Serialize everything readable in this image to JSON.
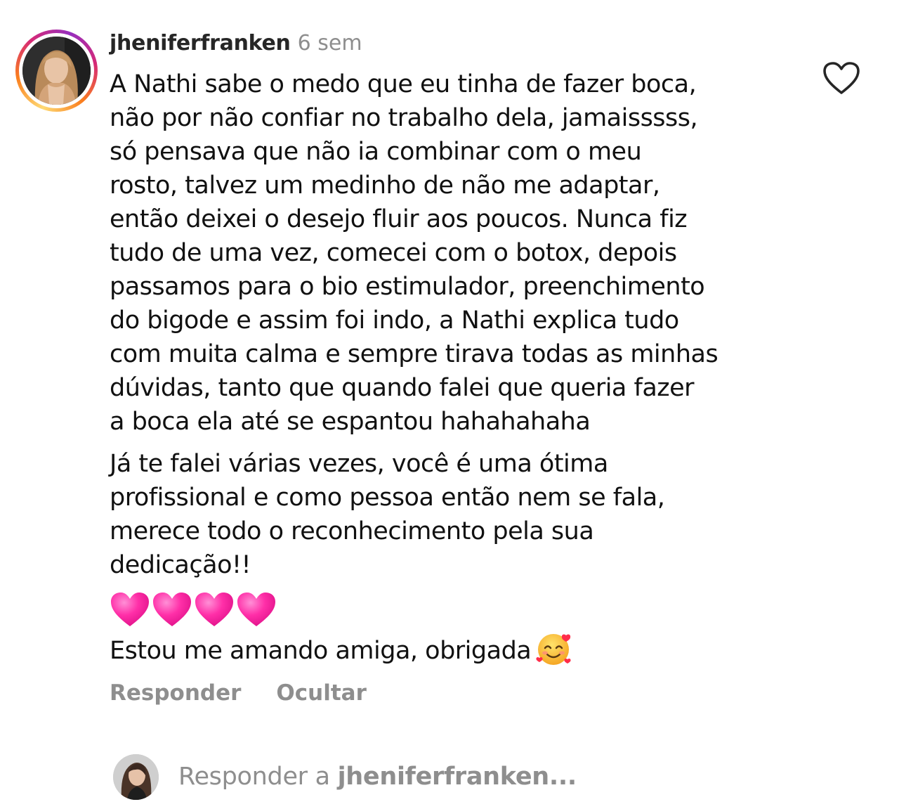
{
  "comment": {
    "username": "jheniferfranken",
    "timestamp": "6 sem",
    "paragraph_1": "A Nathi sabe o medo que eu tinha de fazer boca,\nnão por não confiar no trabalho dela, jamaisssss,\nsó pensava que não ia combinar com o meu\nrosto, talvez um medinho de não me adaptar,\nentão deixei o desejo fluir aos poucos. Nunca fiz\ntudo de uma vez, comecei com o botox, depois\npassamos para o bio estimulador, preenchimento\ndo bigode e assim foi indo, a Nathi explica tudo\ncom muita calma e sempre tirava todas as minhas\ndúvidas, tanto que quando falei que queria fazer\na boca ela até se espantou hahahahaha",
    "paragraph_2": "Já te falei várias vezes, você é uma ótima\nprofissional e como pessoa então nem se fala,\nmerece todo o reconhecimento pela sua\ndedicação!!",
    "hearts": [
      "pink-heart",
      "pink-heart",
      "pink-heart",
      "pink-heart"
    ],
    "paragraph_3": "Estou me amando amiga, obrigada",
    "paragraph_3_emoji": "smiling-face-with-hearts",
    "actions": {
      "reply_label": "Responder",
      "hide_label": "Ocultar"
    },
    "like_icon": "heart-outline-icon",
    "ring_colors": [
      "#feda75",
      "#fa7e1e",
      "#d62976",
      "#962fbf"
    ]
  },
  "reply_bar": {
    "prefix": "Responder a ",
    "target": "jheniferfranken..."
  },
  "colors": {
    "text": "#111111",
    "secondary": "#8e8e8e",
    "heart_pink": "#ff2fa8"
  }
}
